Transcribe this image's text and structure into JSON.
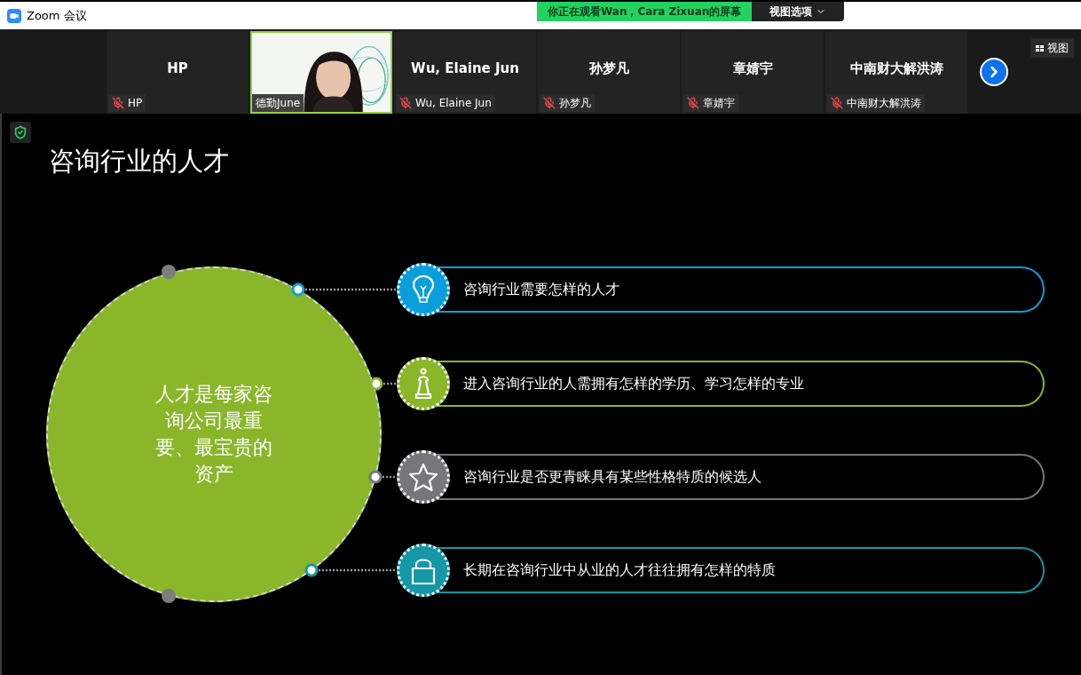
{
  "window": {
    "title": "Zoom 会议"
  },
  "share_banner": {
    "text": "你正在观看Wan，Cara  Zixuan的屏幕",
    "options_button": "视图选项"
  },
  "participants": [
    {
      "kind": "name",
      "name": "HP",
      "label": "HP",
      "muted": true,
      "speaking": false
    },
    {
      "kind": "video",
      "label": "德勤June",
      "muted": false,
      "speaking": true
    },
    {
      "kind": "name",
      "name": "Wu, Elaine Jun",
      "label": "Wu, Elaine Jun",
      "muted": true,
      "speaking": false
    },
    {
      "kind": "name",
      "name": "孙梦凡",
      "label": "孙梦凡",
      "muted": true,
      "speaking": false
    },
    {
      "kind": "name",
      "name": "章婧宇",
      "label": "章婧宇",
      "muted": true,
      "speaking": false
    },
    {
      "kind": "name",
      "name": "中南财大解洪涛",
      "label": "中南财大解洪涛",
      "muted": true,
      "speaking": false
    }
  ],
  "view_button": "视图",
  "slide": {
    "title": "咨询行业的人才",
    "center_text": "人才是每家咨询公司最重要、最宝贵的资产",
    "items": [
      {
        "kind": "bulb",
        "text": "咨询行业需要怎样的人才",
        "color": "#0a9fdc"
      },
      {
        "kind": "pawn",
        "text": "进入咨询行业的人需拥有怎样的学历、学习怎样的专业",
        "color": "#8ab62a"
      },
      {
        "kind": "star",
        "text": "咨询行业是否更青睐具有某些性格特质的候选人",
        "color": "#77767c"
      },
      {
        "kind": "lock",
        "text": "长期在咨询行业中从业的人才往往拥有怎样的特质",
        "color": "#1597a6"
      }
    ]
  }
}
